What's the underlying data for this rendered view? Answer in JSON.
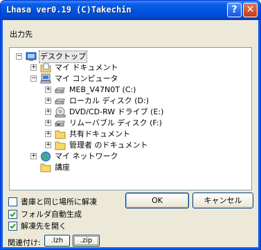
{
  "window": {
    "title": "Lhasa ver0.19 (C)Takechin",
    "help_symbol": "?",
    "close_symbol": "✕"
  },
  "dialog": {
    "destination_label": "出力先",
    "tree": [
      {
        "label": "デスクトップ",
        "expander": "−",
        "icon": "desktop-icon",
        "selected": true
      },
      {
        "label": "マイ ドキュメント",
        "expander": "+",
        "icon": "my-documents-icon"
      },
      {
        "label": "マイ コンピュータ",
        "expander": "−",
        "icon": "my-computer-icon"
      },
      {
        "label": "MEB_V47N0T (C:)",
        "expander": "+",
        "icon": "hard-drive-icon"
      },
      {
        "label": "ローカル ディスク (D:)",
        "expander": "+",
        "icon": "hard-drive-icon"
      },
      {
        "label": "DVD/CD-RW ドライブ (E:)",
        "expander": "+",
        "icon": "dvd-drive-icon"
      },
      {
        "label": "リムーバブル ディスク (F:)",
        "expander": "+",
        "icon": "removable-disk-icon"
      },
      {
        "label": "共有ドキュメント",
        "expander": "+",
        "icon": "folder-icon"
      },
      {
        "label": "管理者 のドキュメント",
        "expander": "+",
        "icon": "folder-icon"
      },
      {
        "label": "マイ ネットワーク",
        "expander": "+",
        "icon": "network-icon"
      },
      {
        "label": "講座",
        "expander": "",
        "icon": "folder-icon"
      }
    ],
    "checkboxes": [
      {
        "label": "書庫と同じ場所に解凍",
        "checked": false
      },
      {
        "label": "フォルダ自動生成",
        "checked": true
      },
      {
        "label": "解凍先を開く",
        "checked": true
      }
    ],
    "ok_label": "OK",
    "cancel_label": "キャンセル",
    "association_label": "関連付け:",
    "association_buttons": [
      ".lzh",
      ".zip"
    ]
  }
}
